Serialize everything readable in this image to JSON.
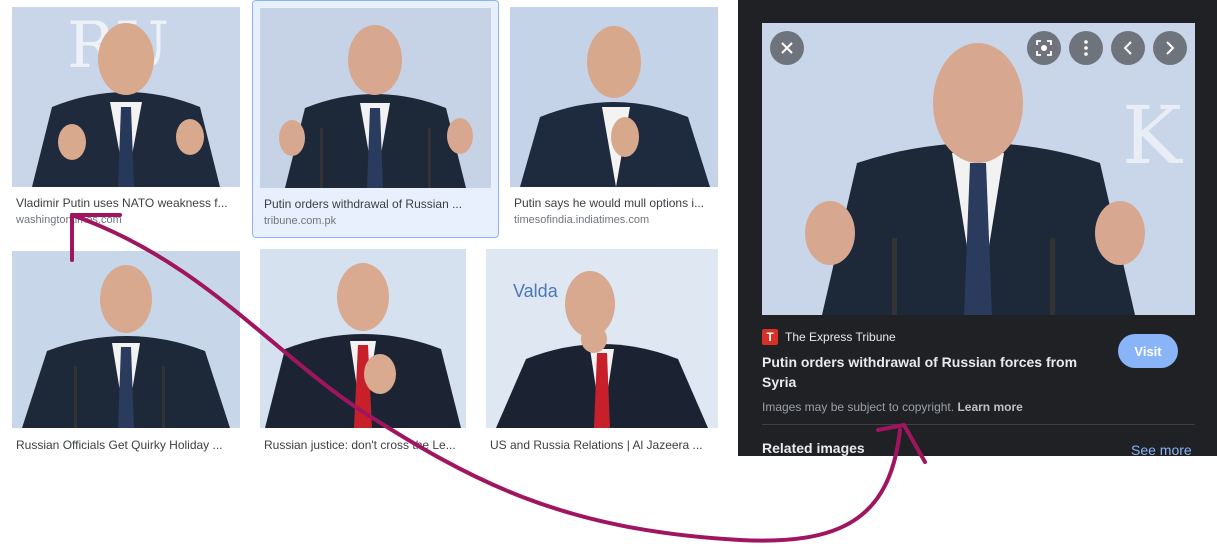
{
  "results": [
    {
      "title": "Vladimir Putin uses NATO weakness f...",
      "source": "washingtontimes.com"
    },
    {
      "title": "Putin orders withdrawal of Russian ...",
      "source": "tribune.com.pk"
    },
    {
      "title": "Putin says he would mull options i...",
      "source": "timesofindia.indiatimes.com"
    },
    {
      "title": "Russian Officials Get Quirky Holiday ...",
      "source": ""
    },
    {
      "title": "Russian justice: don't cross the Le...",
      "source": ""
    },
    {
      "title": "US and Russia Relations | Al Jazeera ...",
      "source": ""
    }
  ],
  "panel": {
    "source_logo": "T",
    "source_name": "The Express Tribune",
    "title": "Putin orders withdrawal of Russian forces from Syria",
    "visit_label": "Visit",
    "copyright_text": "Images may be subject to copyright.",
    "learn_more": "Learn more",
    "related_label": "Related images",
    "see_more": "See more",
    "controls": [
      "close-icon",
      "lens-icon",
      "more-vert-icon",
      "chevron-left-icon",
      "chevron-right-icon"
    ],
    "background_color": "#202124",
    "accent_color": "#8ab4f8"
  },
  "overlay_text": {
    "valdai": "Valda"
  },
  "annotation_color": "#a0155f"
}
